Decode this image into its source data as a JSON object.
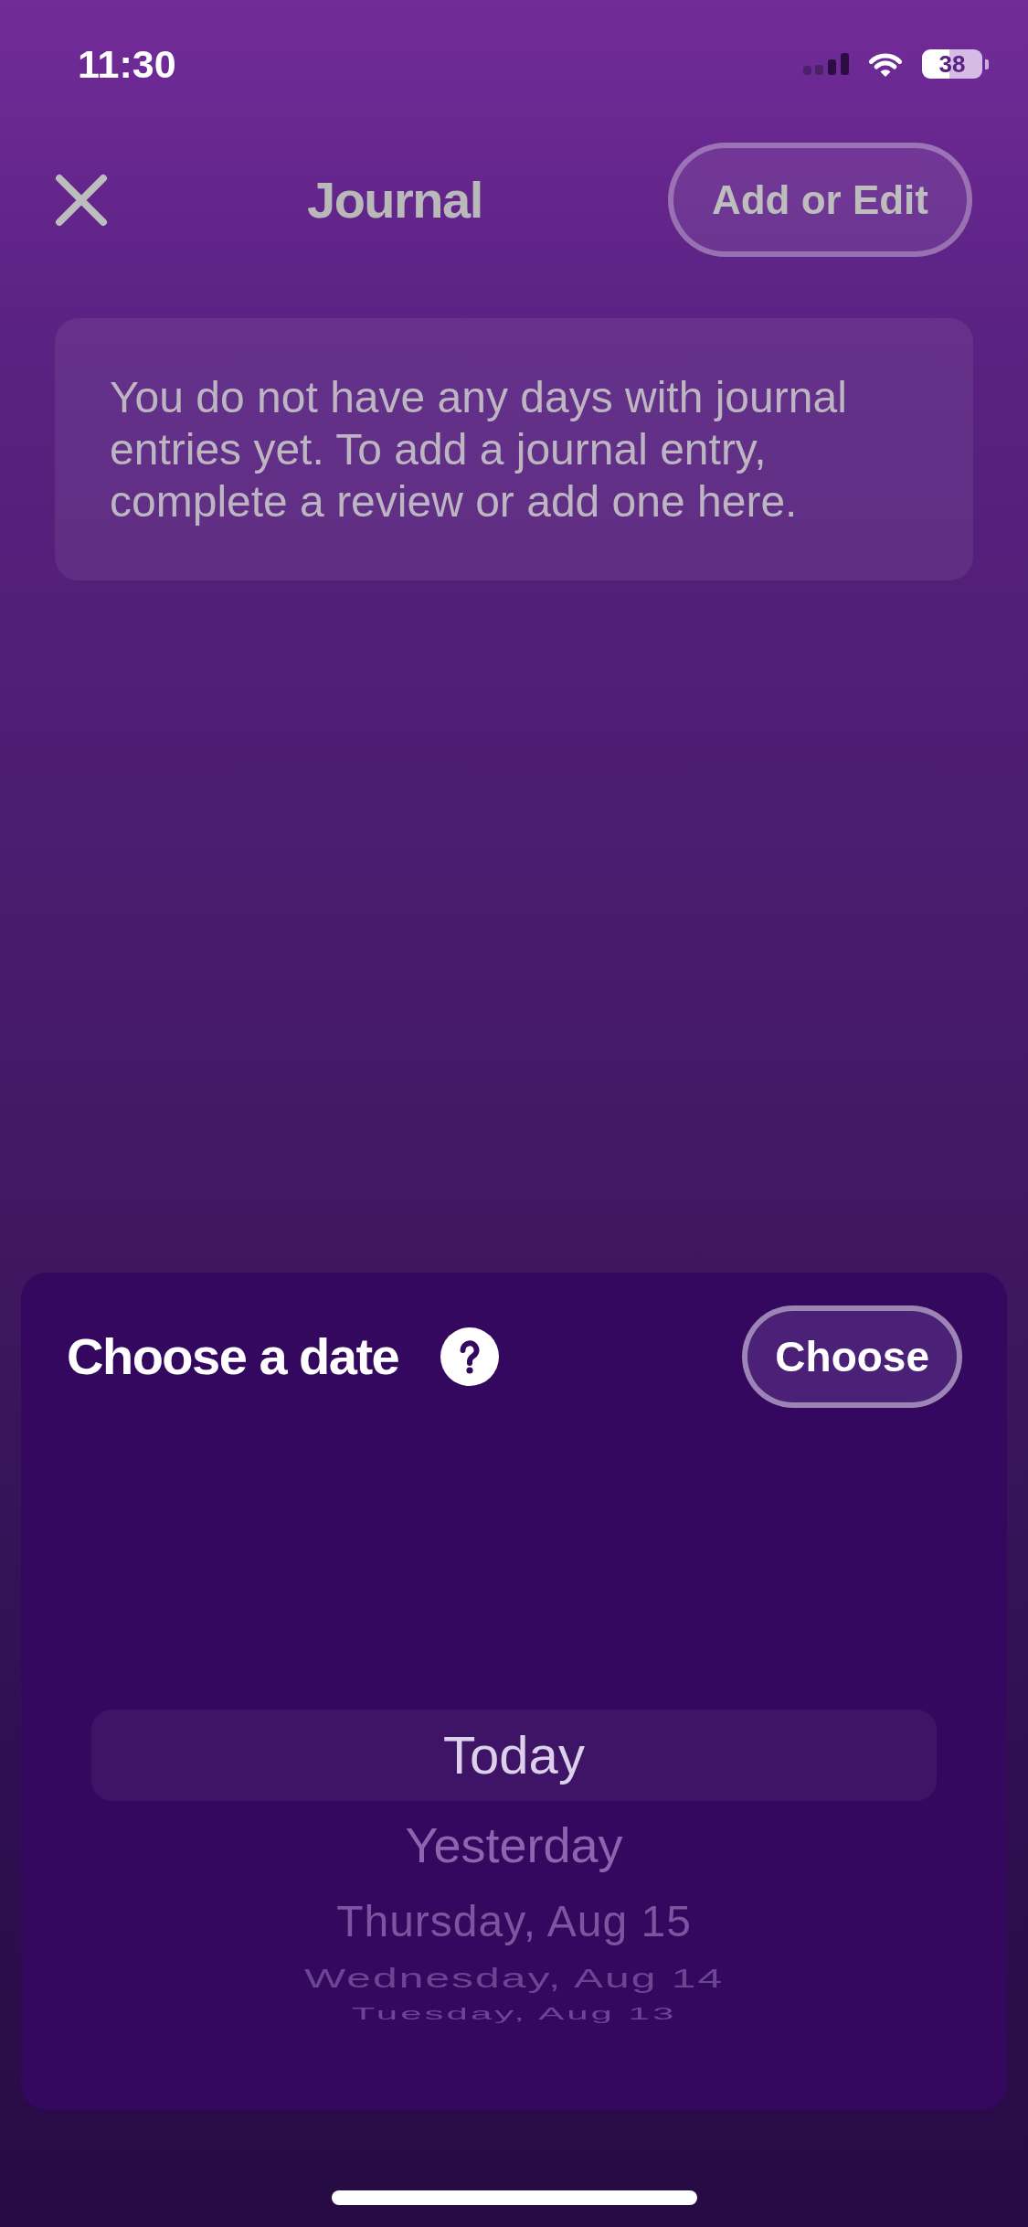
{
  "status_bar": {
    "time": "11:30",
    "battery": "38"
  },
  "header": {
    "title": "Journal",
    "action_button": "Add or Edit"
  },
  "notice": {
    "text": "You do not have any days with journal entries yet. To add a journal entry, complete a review or add one here."
  },
  "date_panel": {
    "title": "Choose a date",
    "button": "Choose",
    "picker": [
      {
        "label": "Today",
        "selected": true
      },
      {
        "label": "Yesterday",
        "selected": false
      },
      {
        "label": "Thursday, Aug 15",
        "selected": false
      },
      {
        "label": "Wednesday, Aug 14",
        "selected": false
      },
      {
        "label": "Tuesday, Aug 13",
        "selected": false
      }
    ]
  }
}
